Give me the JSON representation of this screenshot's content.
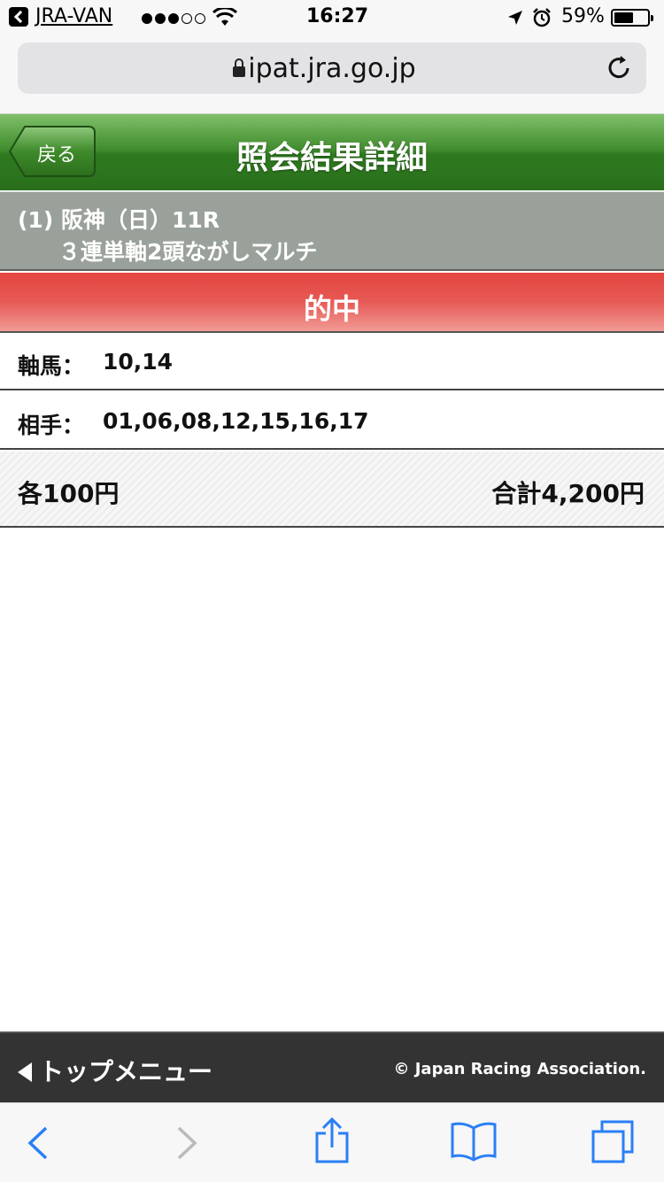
{
  "status_bar": {
    "app_back_label": "JRA-VAN",
    "time": "16:27",
    "battery_text": "59%",
    "battery_level": 0.59,
    "signal_bars_filled": 3,
    "signal_bars_total": 5
  },
  "browser": {
    "url": "ipat.jra.go.jp"
  },
  "header": {
    "back_label": "戻る",
    "title": "照会結果詳細"
  },
  "race": {
    "line1": "(1) 阪神（日）11R",
    "line2": "３連単軸2頭ながしマルチ"
  },
  "result": {
    "label": "的中"
  },
  "bet": {
    "axis_label": "軸馬：",
    "axis_value": "10,14",
    "partner_label": "相手：",
    "partner_value": "01,06,08,12,15,16,17",
    "each_amount": "各100円",
    "total_amount": "合計4,200円"
  },
  "footer": {
    "top_menu_label": "トップメニュー",
    "copyright": "© Japan Racing Association."
  },
  "colors": {
    "header_green": "#3f8a2c",
    "result_red": "#e4453f",
    "ios_blue": "#2a7ff6"
  }
}
